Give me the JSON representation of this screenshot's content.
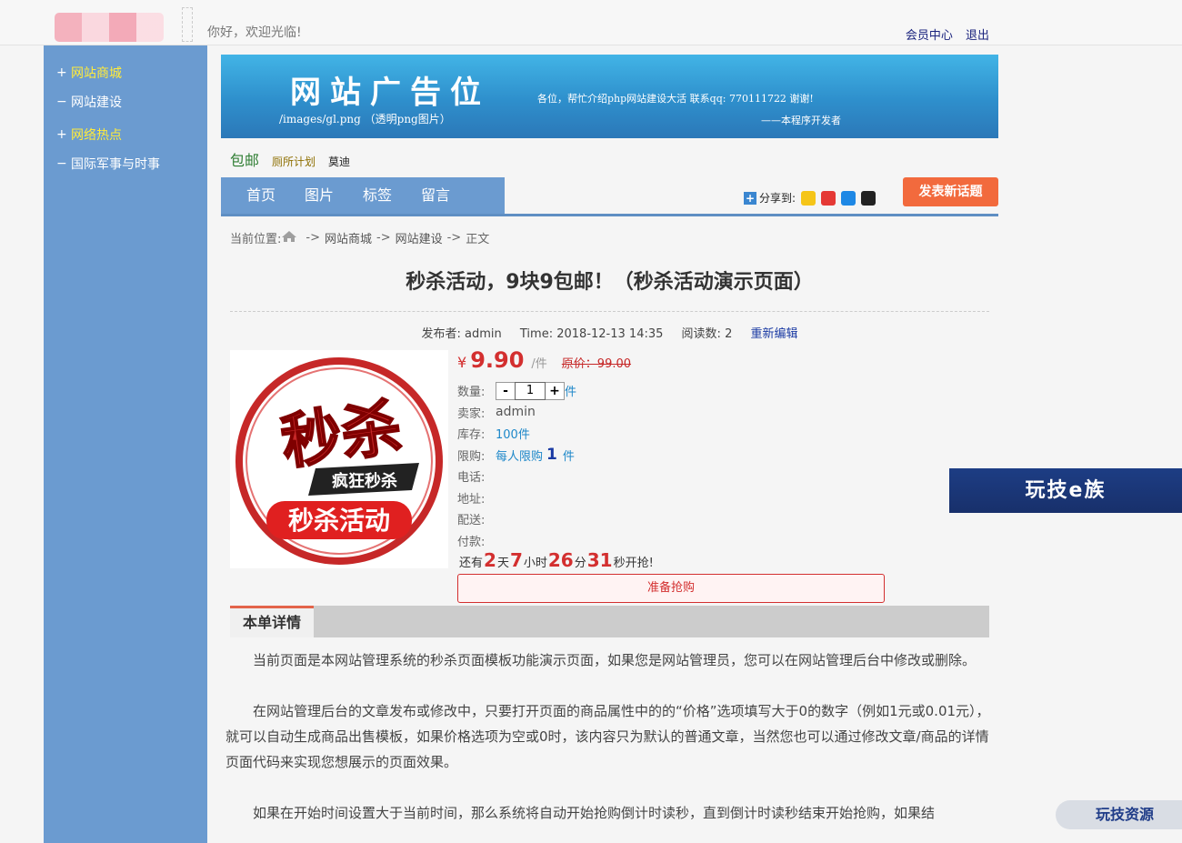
{
  "header": {
    "welcome": "你好，欢迎光临!",
    "member_center": "会员中心",
    "logout": "退出"
  },
  "sidebar": {
    "items": [
      {
        "symbol": "+",
        "label": "网站商城",
        "highlight": true
      },
      {
        "symbol": "−",
        "label": "网站建设",
        "highlight": false
      },
      {
        "symbol": "+",
        "label": "网络热点",
        "highlight": true
      },
      {
        "symbol": "−",
        "label": "国际军事与时事",
        "highlight": false
      }
    ]
  },
  "banner": {
    "title": "网站广告位",
    "path": "/images/gl.png （透明png图片）",
    "intro": "各位，帮忙介绍php网站建设大活  联系qq: 770111722 谢谢!",
    "dev": "——本程序开发者"
  },
  "tags": [
    "包邮",
    "厕所计划",
    "莫迪"
  ],
  "nav": [
    "首页",
    "图片",
    "标签",
    "留言"
  ],
  "share": {
    "label": "分享到:",
    "icons": [
      "qzone-icon",
      "weibo-icon",
      "tencent-weibo-icon",
      "qq-icon"
    ]
  },
  "post_button": "发表新话题",
  "breadcrumb": {
    "label": "当前位置:",
    "sep": "->",
    "items": [
      "网站商城",
      "网站建设",
      "正文"
    ]
  },
  "article": {
    "title": "秒杀活动，9块9包邮！（秒杀活动演示页面）",
    "publisher_label": "发布者:",
    "publisher": "admin",
    "time_label": "Time:",
    "time": "2018-12-13 14:35",
    "views_label": "阅读数:",
    "views": "2",
    "edit": "重新编辑"
  },
  "product": {
    "image_text_top": "秒杀",
    "image_text_mid": "疯狂秒杀",
    "image_text_bottom": "秒杀活动",
    "currency": "¥",
    "price": "9.90",
    "unit": "/件",
    "original_price": "原价：99.00",
    "qty_label": "数量:",
    "qty_minus": "-",
    "qty_value": "1",
    "qty_plus": "+",
    "qty_unit": "件",
    "seller_label": "卖家:",
    "seller": "admin",
    "stock_label": "库存:",
    "stock": "100件",
    "limit_label": "限购:",
    "limit_text": "每人限购",
    "limit_num": "1",
    "limit_unit": "件",
    "phone_label": "电话:",
    "address_label": "地址:",
    "delivery_label": "配送:",
    "payment_label": "付款:",
    "countdown": {
      "prefix": "还有",
      "days": "2",
      "days_unit": "天",
      "hours": "7",
      "hours_unit": "小时",
      "minutes": "26",
      "minutes_unit": "分",
      "seconds": "31",
      "seconds_unit": "秒开抢!"
    },
    "buy_button": "准备抢购"
  },
  "details": {
    "tab": "本单详情",
    "paragraphs": [
      "当前页面是本网站管理系统的秒杀页面模板功能演示页面，如果您是网站管理员，您可以在网站管理后台中修改或删除。",
      "在网站管理后台的文章发布或修改中，只要打开页面的商品属性中的的“价格”选项填写大于0的数字（例如1元或0.01元），就可以自动生成商品出售模板，如果价格选项为空或0时，该内容只为默认的普通文章，当然您也可以通过修改文章/商品的详情页面代码来实现您想展示的页面效果。",
      "如果在开始时间设置大于当前时间，那么系统将自动开始抢购倒计时读秒，直到倒计时读秒结束开始抢购，如果结"
    ]
  },
  "watermarks": {
    "right": "玩技e族",
    "bottom": "玩技资源"
  },
  "colors": {
    "sidebar": "#6b9bd0",
    "accent_red": "#d32f2f",
    "post_button": "#f26a3d",
    "highlight_yellow": "#ffeb3b"
  }
}
